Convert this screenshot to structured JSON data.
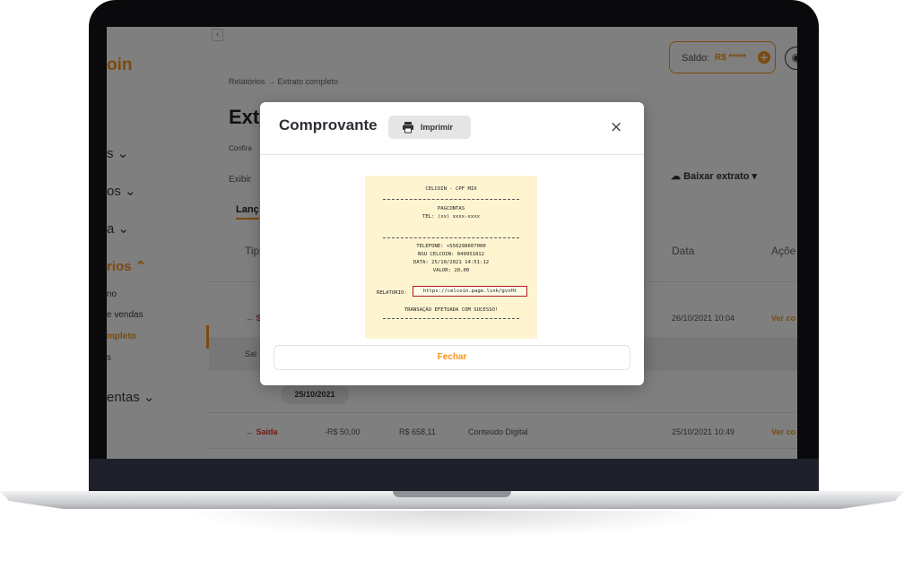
{
  "sidebar": {
    "brand": "oin",
    "items": [
      {
        "label": "s ⌄"
      },
      {
        "label": "os ⌄"
      },
      {
        "label": "a ⌄"
      },
      {
        "label": "rios ⌃"
      },
      {
        "label": "entas ⌄"
      }
    ],
    "subitems": [
      {
        "label": "no"
      },
      {
        "label": "e vendas"
      },
      {
        "label": "mpleto"
      },
      {
        "label": "s"
      }
    ]
  },
  "header": {
    "breadcrumb": "Relatórios → Extrato completo",
    "balance_label": "Saldo:",
    "balance_value": "R$ *****"
  },
  "page": {
    "title": "Extr",
    "subtitle": "Confira",
    "filter_label": "Exibir",
    "tab": "Lanç",
    "download": "Baixar extrato ▾",
    "columns": {
      "type": "Tip",
      "date": "Data",
      "actions": "Açõe"
    }
  },
  "rows": [
    {
      "kind": "← S",
      "date": "26/10/2021 10:04",
      "action": "Ver co"
    },
    {
      "kind": "← Saída",
      "value": "-R$ 50,00",
      "balance": "R$ 658,11",
      "description": "Conteúdo Digital",
      "date": "25/10/2021 10:49",
      "action": "Ver co"
    }
  ],
  "saldo_row": {
    "label": "Sal"
  },
  "date_group": "25/10/2021",
  "modal": {
    "title": "Comprovante",
    "print": "Imprimir",
    "close": "×",
    "fechar": "Fechar"
  },
  "receipt": {
    "title": "CELCOIN - CPF MIX",
    "company": "PAGCONTAS",
    "tel": "TEL: (xx) xxxx-xxxx",
    "telefone": "TELEFONE: +556298607000",
    "nsu": "NSU CELCOIN: 049951812",
    "data": "DATA: 25/10/2021 14:51:12",
    "valor": "VALOR: 20,00",
    "relatorio_label": "RELATORIO:",
    "relatorio_link": "https://celcoin.page.link/gvxHt",
    "status": "TRANSAÇÃO EFETUADA COM SUCESSO!"
  },
  "colors": {
    "accent": "#f7941d",
    "exit": "#e2342d",
    "receipt_bg": "#fef5d0"
  }
}
